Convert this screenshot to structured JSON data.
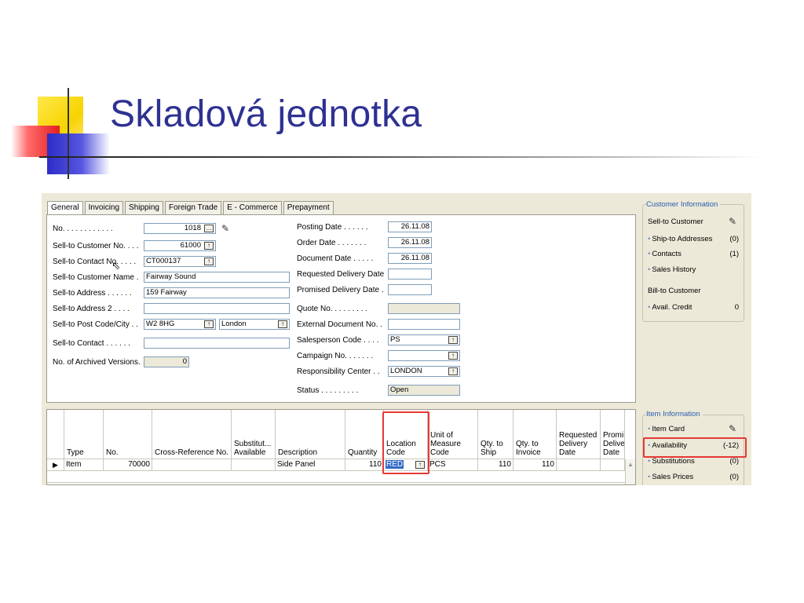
{
  "slide": {
    "title": "Skladová jednotka"
  },
  "tabs": [
    "General",
    "Invoicing",
    "Shipping",
    "Foreign Trade",
    "E - Commerce",
    "Prepayment"
  ],
  "general": {
    "left": [
      {
        "label": "No. . . . . . . . . . . .",
        "value": "1018",
        "lookup": "...",
        "edit_icon": true
      },
      {
        "label": "Sell-to Customer No. . . .",
        "value": "61000",
        "lookup": "↑"
      },
      {
        "label": "Sell-to Contact No. . . . .",
        "value": "CT000137",
        "lookup": "↑"
      },
      {
        "label": "Sell-to Customer Name  .",
        "value": "Fairway Sound"
      },
      {
        "label": "Sell-to Address . . . . . .",
        "value": "159 Fairway"
      },
      {
        "label": "Sell-to Address 2 . . . .",
        "value": ""
      },
      {
        "label": "Sell-to Post Code/City . .",
        "value": "W2 8HG",
        "value2": "London",
        "lookup": "↑"
      },
      {
        "label": "Sell-to Contact . . . . . .",
        "value": ""
      },
      {
        "label": "No. of Archived Versions.",
        "value": "0"
      }
    ],
    "right": [
      {
        "label": "Posting Date . . . . . .",
        "value": "26.11.08"
      },
      {
        "label": "Order Date . . . . . . .",
        "value": "26.11.08"
      },
      {
        "label": "Document Date . . . . .",
        "value": "26.11.08"
      },
      {
        "label": "Requested Delivery Date",
        "value": ""
      },
      {
        "label": "Promised Delivery Date  .",
        "value": ""
      },
      {
        "label": "Quote No. . . . . . . . .",
        "value": ""
      },
      {
        "label": "External Document No.  .",
        "value": ""
      },
      {
        "label": "Salesperson Code . . . .",
        "value": "PS"
      },
      {
        "label": "Campaign No. . . . . . .",
        "value": ""
      },
      {
        "label": "Responsibility Center  . .",
        "value": "LONDON"
      },
      {
        "label": "Status  . . . . . . . . .",
        "value": "Open"
      }
    ]
  },
  "lines": {
    "columns": [
      "Type",
      "No.",
      "Cross-Reference No.",
      "Substitut...\nAvailable",
      "Description",
      "Quantity",
      "Location\nCode",
      "Unit of\nMeasure\nCode",
      "Qty. to\nShip",
      "Qty. to\nInvoice",
      "Requested\nDelivery\nDate",
      "Promis\nDelive\nDate"
    ],
    "row": {
      "indicator": "▶",
      "type": "Item",
      "no": "70000",
      "cross_ref": "",
      "substitutes": "",
      "description": "Side Panel",
      "quantity": "110",
      "location_code": "RED",
      "location_lookup": "↑",
      "uom": "PCS",
      "qty_to_ship": "110",
      "qty_to_invoice": "110",
      "requested": "",
      "promised": ""
    }
  },
  "customer_info": {
    "title": "Customer Information",
    "sell_to_customer": "Sell-to Customer",
    "ship_to_addresses": {
      "label": "Ship-to Addresses",
      "value": "(0)"
    },
    "contacts": {
      "label": "Contacts",
      "value": "(1)"
    },
    "sales_history": "Sales History",
    "bill_to_customer": "Bill-to Customer",
    "avail_credit": {
      "label": "Avail. Credit",
      "value": "0"
    }
  },
  "item_info": {
    "title": "Item Information",
    "item_card": "Item Card",
    "availability": {
      "label": "Availability",
      "value": "(-12)"
    },
    "substitutions": {
      "label": "Substitutions",
      "value": "(0)"
    },
    "sales_prices": {
      "label": "Sales Prices",
      "value": "(0)"
    }
  },
  "colors": {
    "title": "#2e3192",
    "highlight_box": "#e53935",
    "nav_background": "#ece9d8",
    "selection": "#316ac5"
  }
}
